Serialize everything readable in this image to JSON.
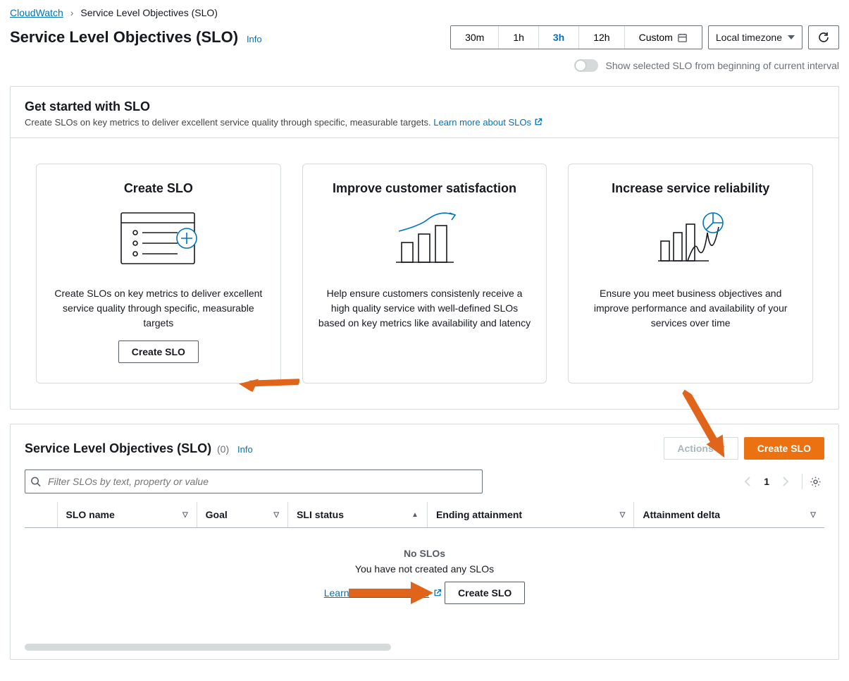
{
  "breadcrumb": {
    "root": "CloudWatch",
    "current": "Service Level Objectives (SLO)"
  },
  "header": {
    "title": "Service Level Objectives (SLO)",
    "info": "Info"
  },
  "timerange": {
    "opts": [
      "30m",
      "1h",
      "3h",
      "12h"
    ],
    "active": "3h",
    "custom": "Custom",
    "timezone": "Local timezone"
  },
  "toggle": {
    "label": "Show selected SLO from beginning of current interval"
  },
  "getstarted": {
    "title": "Get started with SLO",
    "subtitle": "Create SLOs on key metrics to deliver excellent service quality through specific, measurable targets.",
    "learn": "Learn more about SLOs",
    "cards": [
      {
        "title": "Create SLO",
        "body": "Create SLOs on key metrics to deliver excellent service quality through specific, measurable targets",
        "cta": "Create SLO"
      },
      {
        "title": "Improve customer satisfaction",
        "body": "Help ensure customers consistenly receive a high quality service with well-defined SLOs based on key metrics like availability and latency"
      },
      {
        "title": "Increase service reliability",
        "body": "Ensure you meet business objectives and improve performance and availability of your services over time"
      }
    ]
  },
  "list": {
    "title": "Service Level Objectives (SLO)",
    "count": "(0)",
    "info": "Info",
    "actions": "Actions",
    "create": "Create SLO",
    "searchPlaceholder": "Filter SLOs by text, property or value",
    "page": "1",
    "columns": {
      "name": "SLO name",
      "goal": "Goal",
      "sli": "SLI status",
      "ending": "Ending attainment",
      "delta": "Attainment delta"
    },
    "empty": {
      "title": "No SLOs",
      "sub": "You have not created any SLOs",
      "learn": "Learn more about SLOs",
      "cta": "Create SLO"
    }
  }
}
